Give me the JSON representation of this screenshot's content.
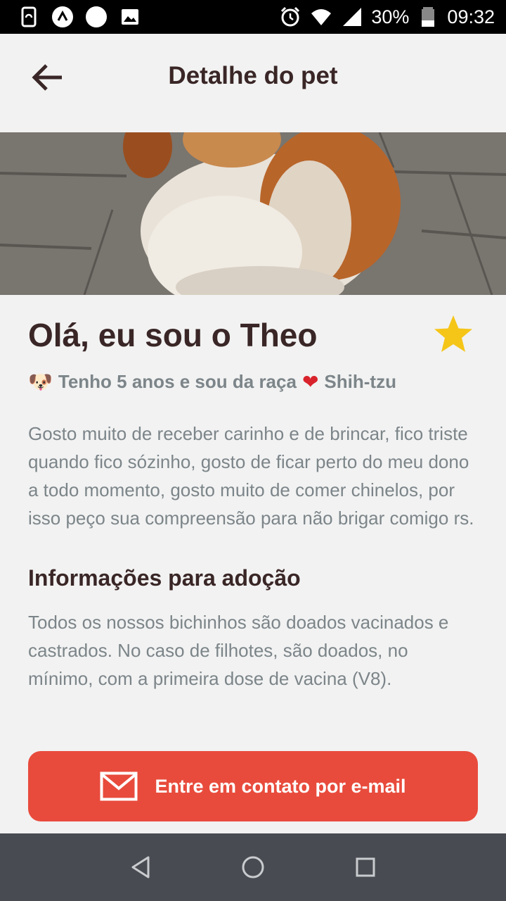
{
  "status_bar": {
    "battery": "30%",
    "time": "09:32",
    "icons": [
      "phone-sync-icon",
      "app-notification-icon",
      "circle-notification-icon",
      "image-notification-icon",
      "alarm-icon",
      "wifi-icon",
      "signal-icon",
      "battery-icon"
    ]
  },
  "header": {
    "title": "Detalhe do pet",
    "back_icon": "arrow-left-icon"
  },
  "pet": {
    "name_title": "Olá, eu sou o Theo",
    "favorite_icon": "star-icon",
    "favorite_color": "#f5c518",
    "sub_emoji": "🐶",
    "sub_text": "Tenho 5 anos e sou da raça",
    "heart_emoji": "❤",
    "breed": "Shih-tzu",
    "description": "Gosto muito de receber carinho e de brincar, fico triste quando fico sózinho, gosto de ficar perto do meu dono a todo momento, gosto muito de comer chinelos, por isso peço sua compreensão para não brigar comigo rs."
  },
  "adoption": {
    "title": "Informações para adoção",
    "text": "Todos os nossos bichinhos são doados vacinados e castrados. No caso de filhotes, são doados, no mínimo, com a primeira dose de vacina (V8)."
  },
  "cta": {
    "label": "Entre em contato por e-mail",
    "icon": "mail-icon",
    "color": "#e84b3c"
  },
  "nav": {
    "icons": [
      "back-triangle-icon",
      "home-circle-icon",
      "recents-square-icon"
    ]
  }
}
